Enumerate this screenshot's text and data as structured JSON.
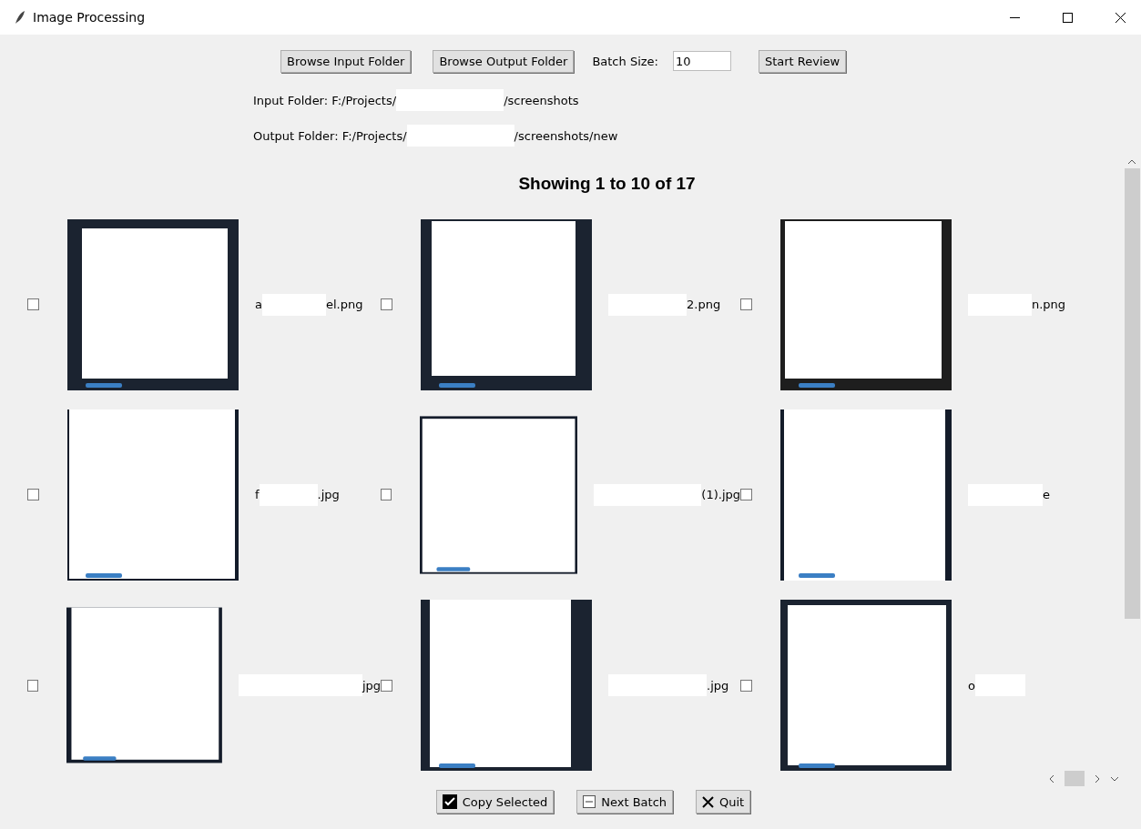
{
  "window": {
    "title": "Image Processing"
  },
  "toolbar": {
    "browse_input": "Browse Input Folder",
    "browse_output": "Browse Output Folder",
    "batch_label": "Batch Size:",
    "batch_value": "10",
    "start": "Start Review"
  },
  "folders": [
    {
      "before": "Input Folder: F:/Projects/",
      "after": "/screenshots"
    },
    {
      "before": "Output Folder: F:/Projects/",
      "after": "/screenshots/new"
    }
  ],
  "heading": "Showing 1 to 10 of 17",
  "images": [
    {
      "before": "a",
      "after": "el.png",
      "checked": false
    },
    {
      "after": "2.png",
      "checked": false
    },
    {
      "after": "n.png",
      "checked": false
    },
    {
      "before": "f",
      "after": ".jpg",
      "checked": false
    },
    {
      "after": "(1).jpg",
      "checked": false
    },
    {
      "after": "e",
      "checked": false
    },
    {
      "after": "jpg",
      "checked": false
    },
    {
      "after": ".jpg",
      "checked": false
    },
    {
      "before": "o",
      "checked": false
    }
  ],
  "actions": [
    {
      "kind": "check",
      "label": "Copy Selected"
    },
    {
      "kind": "next",
      "label": "Next Batch"
    },
    {
      "kind": "quit",
      "label": "Quit"
    }
  ]
}
